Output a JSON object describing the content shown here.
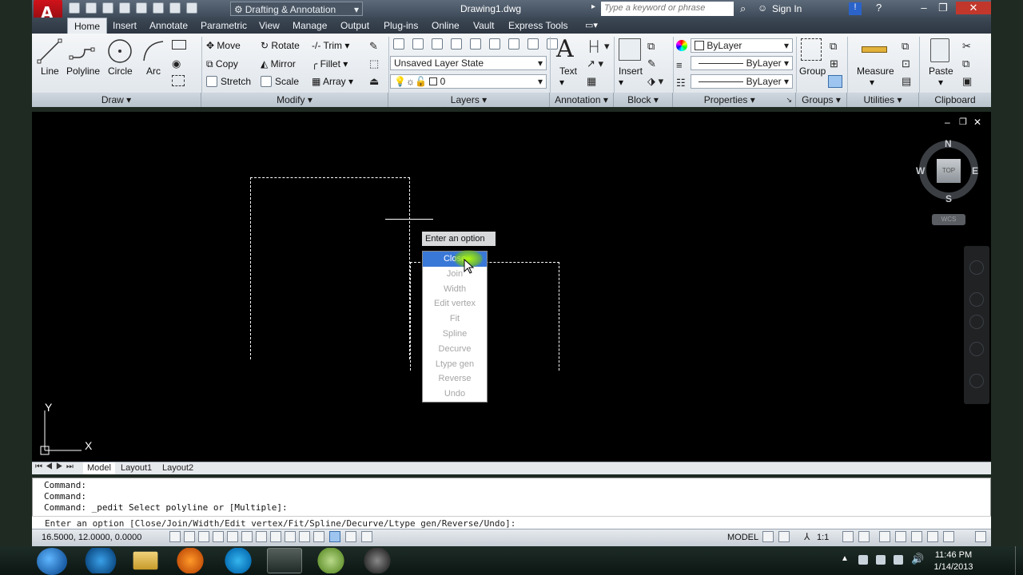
{
  "title_bar": {
    "workspace": "Drafting & Annotation",
    "document": "Drawing1.dwg",
    "search_placeholder": "Type a keyword or phrase",
    "sign_in": "Sign In"
  },
  "ribbon_tabs": [
    "Home",
    "Insert",
    "Annotate",
    "Parametric",
    "View",
    "Manage",
    "Output",
    "Plug-ins",
    "Online",
    "Vault",
    "Express Tools"
  ],
  "active_tab": "Home",
  "draw_panel": {
    "title": "Draw",
    "tools": [
      "Line",
      "Polyline",
      "Circle",
      "Arc"
    ]
  },
  "modify_panel": {
    "title": "Modify",
    "tools": [
      "Move",
      "Rotate",
      "Trim",
      "Copy",
      "Mirror",
      "Fillet",
      "Stretch",
      "Scale",
      "Array"
    ]
  },
  "layers_panel": {
    "title": "Layers",
    "layer_state": "Unsaved Layer State",
    "current_layer": "0"
  },
  "annotation_panel": {
    "title": "Annotation",
    "text_label": "Text"
  },
  "block_panel": {
    "title": "Block",
    "insert_label": "Insert"
  },
  "properties_panel": {
    "title": "Properties",
    "color": "ByLayer",
    "linetype": "ByLayer",
    "lineweight": "ByLayer"
  },
  "groups_panel": {
    "title": "Groups",
    "group_label": "Group"
  },
  "utilities_panel": {
    "title": "Utilities",
    "measure_label": "Measure"
  },
  "clipboard_panel": {
    "title": "Clipboard",
    "paste_label": "Paste"
  },
  "viewcube": {
    "north": "N",
    "south": "S",
    "east": "E",
    "west": "W",
    "face": "TOP",
    "wcs": "WCS"
  },
  "ucs_icon": {
    "x": "X",
    "y": "Y"
  },
  "dynamic_prompt": "Enter an option",
  "options": [
    "Close",
    "Join",
    "Width",
    "Edit vertex",
    "Fit",
    "Spline",
    "Decurve",
    "Ltype gen",
    "Reverse",
    "Undo"
  ],
  "selected_option": "Close",
  "layout_tabs": [
    "Model",
    "Layout1",
    "Layout2"
  ],
  "command_history": [
    "Command:",
    "Command:",
    "Command: _pedit Select polyline or [Multiple]:"
  ],
  "command_prompt": "Enter an option [Close/Join/Width/Edit vertex/Fit/Spline/Decurve/Ltype gen/Reverse/Undo]:",
  "status": {
    "coordinates": "16.5000, 12.0000, 0.0000",
    "model": "MODEL",
    "annotation_scale": "1:1"
  },
  "taskbar": {
    "time": "11:46 PM",
    "date": "1/14/2013"
  },
  "colors": {
    "canvas": "#000000",
    "selected_option": "#3a78d8",
    "app_red": "#d0121b"
  }
}
